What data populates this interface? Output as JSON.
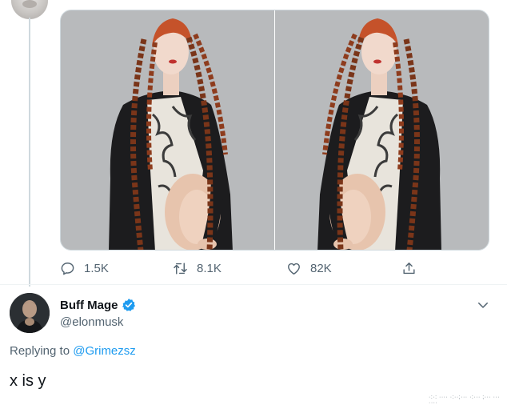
{
  "previous_tweet": {
    "media": [
      {
        "name": "photo-left"
      },
      {
        "name": "photo-right"
      }
    ],
    "actions": {
      "reply_count": "1.5K",
      "retweet_count": "8.1K",
      "like_count": "82K"
    }
  },
  "reply_tweet": {
    "display_name": "Buff Mage",
    "handle": "@elonmusk",
    "verified": true,
    "replying_prefix": "Replying to ",
    "replying_to": "@Grimezsz",
    "text": "x is y"
  },
  "watermark": "·:·: ···· ·:··;··· ·:··· ;··· ··· ····",
  "colors": {
    "accent": "#1d9bf0",
    "secondary_text": "#536471",
    "primary_text": "#0f1419",
    "border": "#cfd9de"
  },
  "icons": [
    "reply-icon",
    "retweet-icon",
    "like-icon",
    "share-icon",
    "verified-badge-icon",
    "chevron-down-icon"
  ]
}
